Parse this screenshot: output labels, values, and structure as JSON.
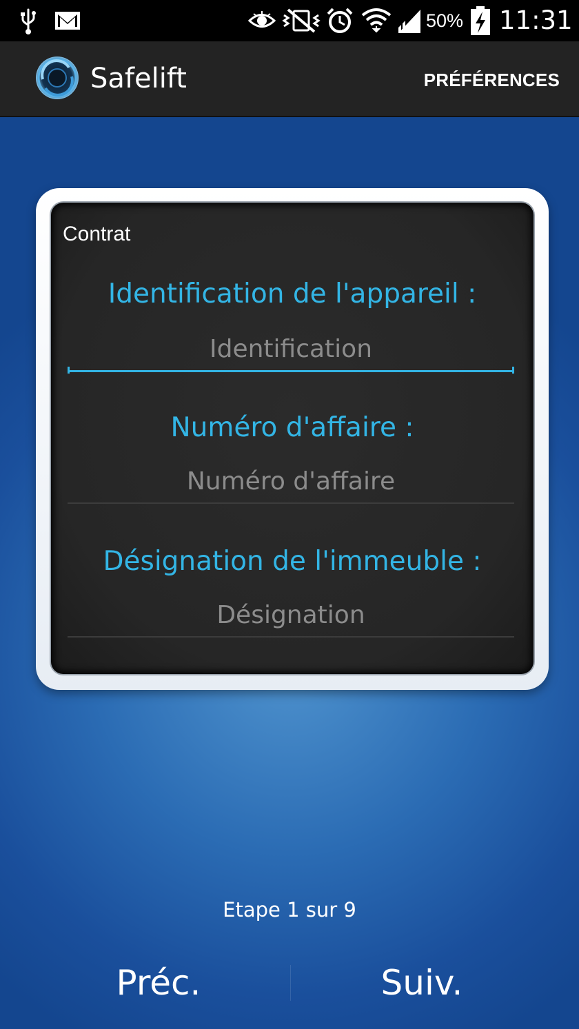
{
  "status_bar": {
    "battery": "50%",
    "time": "11:31",
    "icons": [
      "usb-icon",
      "gmail-icon",
      "eye-icon",
      "vibrate-mute-icon",
      "alarm-icon",
      "wifi-icon",
      "signal-icon",
      "battery-charging-icon"
    ]
  },
  "action_bar": {
    "title": "Safelift",
    "preferences_label": "PRÉFÉRENCES",
    "logo_icon": "safelift-logo-icon"
  },
  "card": {
    "title": "Contrat",
    "fields": [
      {
        "label": "Identification de l'appareil :",
        "value": "",
        "placeholder": "Identification",
        "focused": true
      },
      {
        "label": "Numéro d'affaire :",
        "value": "",
        "placeholder": "Numéro d'affaire",
        "focused": false
      },
      {
        "label": "Désignation de l'immeuble :",
        "value": "",
        "placeholder": "Désignation",
        "focused": false
      }
    ]
  },
  "footer": {
    "step": "Etape 1 sur 9",
    "prev_label": "Préc.",
    "next_label": "Suiv."
  },
  "colors": {
    "accent": "#33b5e5",
    "action_bar": "#232323",
    "background": "#1f5aa6"
  }
}
